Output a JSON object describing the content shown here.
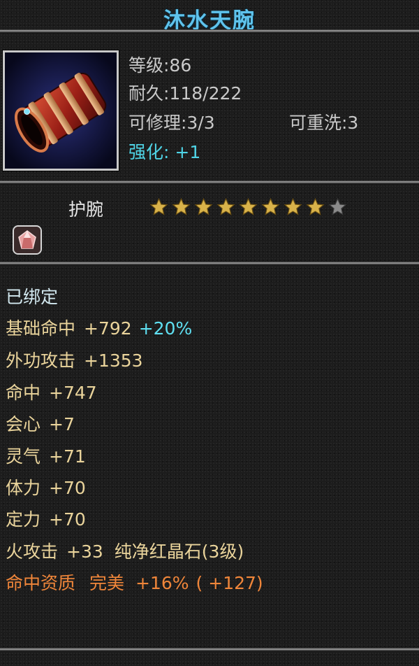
{
  "item": {
    "name": "沐水天腕",
    "level_text": "等级:86",
    "durability_text": "耐久:118/222",
    "repairable_text": "可修理:3/3",
    "rewash_text": "可重洗:3",
    "enhance_text": "强化: +1",
    "type": "护腕",
    "stars_filled": 8,
    "stars_total": 9,
    "bound_text": "已绑定"
  },
  "stats": {
    "base_hit_label": "基础命中",
    "base_hit_value": "+792",
    "base_hit_bonus": "+20%",
    "outer_attack_label": "外功攻击",
    "outer_attack_value": "+1353",
    "hit_label": "命中",
    "hit_value": "+747",
    "crit_label": "会心",
    "crit_value": "+7",
    "spirit_label": "灵气",
    "spirit_value": "+71",
    "stamina_label": "体力",
    "stamina_value": "+70",
    "focus_label": "定力",
    "focus_value": "+70",
    "fire_attack_label": "火攻击",
    "fire_attack_value": "+33",
    "gem_name": "纯净红晶石(3级)",
    "aptitude_label": "命中资质",
    "aptitude_grade": "完美",
    "aptitude_percent": "+16%",
    "aptitude_extra": "( +127)"
  },
  "colors": {
    "title": "#5fc3ec",
    "stat_gold": "#ead49b",
    "bonus_cyan": "#5fe0f2",
    "aptitude_orange": "#f0863a",
    "star_gold": "#d8b24a",
    "star_empty": "#8a8a8a"
  },
  "icons": {
    "item_icon": "red-bracer-icon",
    "gem_icon": "red-gem-icon",
    "star_icon": "star-icon"
  }
}
